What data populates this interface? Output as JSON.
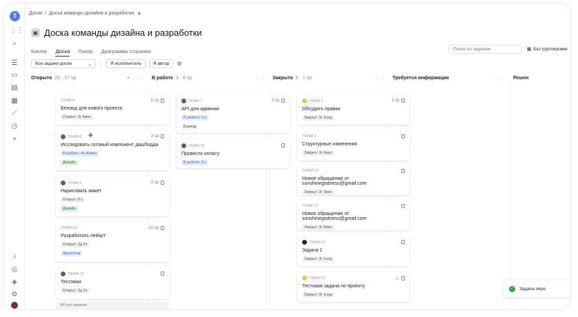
{
  "rail": {
    "logo_letter": "T",
    "icons": [
      "apps-grid-icon",
      "search-icon",
      "list-icon",
      "folders-icon",
      "inbox-icon",
      "table-icon",
      "chart-icon",
      "history-icon",
      "add-icon",
      "bell-icon",
      "globe-icon",
      "shield-icon",
      "settings-icon"
    ]
  },
  "breadcrumb": {
    "root": "Доски",
    "separator": "/",
    "current": "Доска команды дизайна и разработки",
    "star": "★"
  },
  "page": {
    "title": "Доска команды дизайна и разработки"
  },
  "tabs": [
    {
      "label": "Бэклог",
      "active": false
    },
    {
      "label": "Доска",
      "active": true
    },
    {
      "label": "Покер",
      "active": false
    },
    {
      "label": "Диаграмма сгорания",
      "active": false
    }
  ],
  "search": {
    "placeholder": "Поиск по задачам"
  },
  "grouping": {
    "label": "Без группировки"
  },
  "filters": {
    "select_value": "Все задачи доски",
    "assignee_btn": "Я исполнитель",
    "author_btn": "Я автор"
  },
  "columns": [
    {
      "name": "Открыто",
      "meta": "26 · 27 sp",
      "actions": "+ ···",
      "cards": [
        {
          "key": "TRAM-6",
          "avatar": "",
          "estimate": "5 sp",
          "summary": "Бенэнд для нового проекта",
          "chips": [
            {
              "text": "Открыт: 3г 4мес",
              "style": "gray"
            }
          ]
        },
        {
          "key": "TRAM-5",
          "avatar": "pink",
          "estimate": "3 sp",
          "summary": "Исследовать готовый компонент дашборда",
          "chips": [
            {
              "text": "В работе: 4ч 40мин",
              "style": "blue"
            },
            {
              "text": "Дизайн",
              "style": "green"
            }
          ]
        },
        {
          "key": "TRAM-6",
          "avatar": "pink",
          "estimate": "3 sp",
          "summary": "Нарисовать макет",
          "chips": [
            {
              "text": "Открыт: 8 с",
              "style": "gray"
            },
            {
              "text": "Дизайн",
              "style": "green"
            }
          ]
        },
        {
          "key": "TRAM-15",
          "avatar": "",
          "estimate": "13 sp",
          "summary": "Разработать лейаут",
          "chips": [
            {
              "text": "Открыт: 3д 2ч",
              "style": "gray"
            },
            {
              "text": "Фронтенд",
              "style": "blue"
            }
          ]
        },
        {
          "key": "TRAM-19",
          "avatar": "pink",
          "estimate": "",
          "summary": "Тестовая",
          "chips": [
            {
              "text": "Открыт: 3д 2ч",
              "style": "gray"
            }
          ]
        }
      ],
      "bottom_hint": "API для админки"
    },
    {
      "name": "В работе",
      "meta": "3 · 8 sp",
      "actions": "···",
      "cards": [
        {
          "key": "TRAM-7",
          "avatar": "pink",
          "estimate": "3 sp",
          "summary": "API для админки",
          "chips": [
            {
              "text": "В работе: 0 с",
              "style": "blue"
            },
            {
              "text": "Бэкенд",
              "style": "plain"
            }
          ]
        },
        {
          "key": "TRAM-18",
          "avatar": "pink",
          "estimate": "",
          "summary": "Провести оплату",
          "chips": [
            {
              "text": "В работе: 0 с",
              "style": "blue"
            }
          ]
        }
      ]
    },
    {
      "name": "Закрыто",
      "meta": "6 · 1 sp",
      "actions": "···",
      "cards": [
        {
          "key": "TRAM-2",
          "avatar": "yellow",
          "estimate": "1 sp",
          "summary": "Обсудить правки",
          "chips": [
            {
              "text": "Закрыт: 3г 1нед",
              "style": "gray"
            }
          ]
        },
        {
          "key": "TRAM-3",
          "avatar": "",
          "estimate": "",
          "summary": "Структурные изменения",
          "chips": [
            {
              "text": "Закрыт: 3г 6мес",
              "style": "gray"
            }
          ]
        },
        {
          "key": "TRAM-12",
          "avatar": "",
          "estimate": "",
          "summary": "Новое обращение от sunshinegodness@gmail.com",
          "chips": [
            {
              "text": "Закрыт: 3г 3мес",
              "style": "gray"
            }
          ]
        },
        {
          "key": "TRAM-11",
          "avatar": "",
          "estimate": "",
          "summary": "Новое обращение от sunshinegodness@gmail.com",
          "chips": [
            {
              "text": "Закрыт: 3г 6мес",
              "style": "gray"
            }
          ]
        },
        {
          "key": "TRAM-16",
          "avatar": "dark",
          "estimate": "",
          "summary": "Задача 1",
          "chips": [
            {
              "text": "Закрыт: 3г 1нед",
              "style": "gray"
            }
          ]
        },
        {
          "key": "TRAM-21",
          "avatar": "yellow",
          "estimate": "",
          "warn": "⚠",
          "summary": "Тестовая задача по проекту",
          "chips": [
            {
              "text": "Закрыт: 3г 1нед",
              "style": "gray"
            }
          ]
        }
      ]
    },
    {
      "name": "Требуется информация",
      "meta": "",
      "actions": "···",
      "cards": []
    },
    {
      "name": "Решен",
      "meta": "",
      "actions": "",
      "cards": []
    }
  ],
  "toast": {
    "text": "Задача пере",
    "icon": "check-icon"
  }
}
